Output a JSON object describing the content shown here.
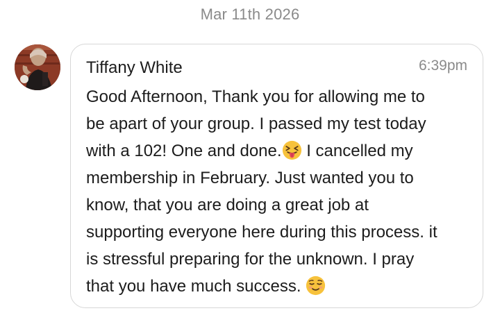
{
  "date_divider": "Mar 11th 2026",
  "message": {
    "sender": "Tiffany White",
    "time": "6:39pm",
    "lines": [
      "Good Afternoon, Thank you for allowing me to",
      "be apart of your group. I passed my test today",
      "with a 102! One and done.",
      "I cancelled my",
      "membership in February. Just wanted you to",
      "know, that you are doing a great job at",
      "supporting everyone here during this process. it",
      "is stressful preparing for the unknown. I pray",
      "that you have much success."
    ],
    "emojis": {
      "first": "squinting-face-with-tongue",
      "second": "smiling-face"
    }
  },
  "colors": {
    "meta_text": "#8a8a8a",
    "body_text": "#1c1c1c",
    "bubble_border": "#d7d7d7",
    "emoji_yellow": "#f7c23c"
  }
}
